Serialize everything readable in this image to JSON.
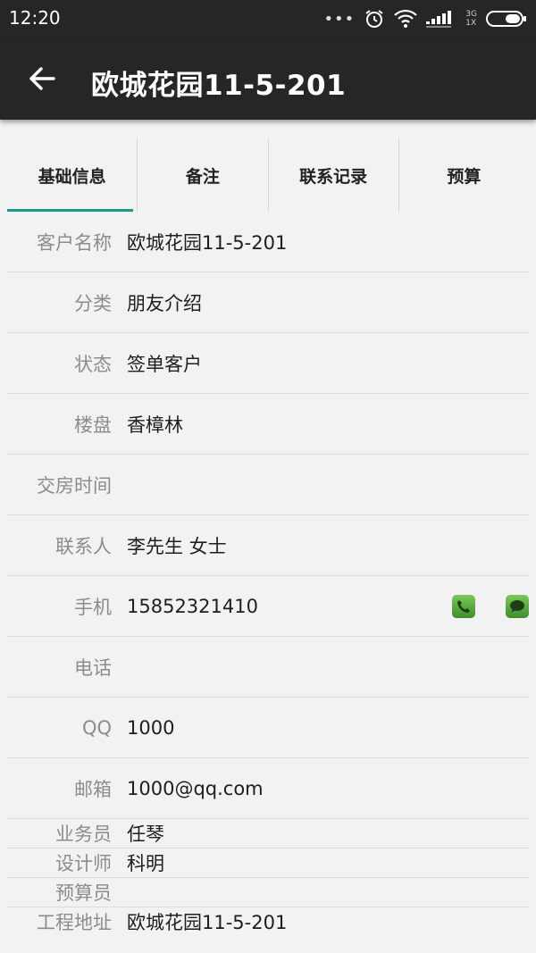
{
  "status": {
    "time": "12:20",
    "network_label_top": "3G",
    "network_label_bottom": "1X",
    "dots": "•••"
  },
  "app_bar": {
    "title": "欧城花园11-5-201"
  },
  "tabs": [
    {
      "label": "基础信息"
    },
    {
      "label": "备注"
    },
    {
      "label": "联系记录"
    },
    {
      "label": "预算"
    }
  ],
  "fields": [
    {
      "label": "客户名称",
      "value": "欧城花园11-5-201"
    },
    {
      "label": "分类",
      "value": "朋友介绍"
    },
    {
      "label": "状态",
      "value": "签单客户"
    },
    {
      "label": "楼盘",
      "value": "香樟林"
    },
    {
      "label": "交房时间",
      "value": ""
    },
    {
      "label": "联系人",
      "value": "李先生 女士"
    },
    {
      "label": "手机",
      "value": "15852321410"
    },
    {
      "label": "电话",
      "value": ""
    },
    {
      "label": "QQ",
      "value": "1000"
    },
    {
      "label": "邮箱",
      "value": "1000@qq.com"
    },
    {
      "label": "业务员",
      "value": "任琴"
    },
    {
      "label": "设计师",
      "value": "科明"
    },
    {
      "label": "预算员",
      "value": ""
    },
    {
      "label": "工程地址",
      "value": "欧城花园11-5-201"
    }
  ],
  "icons": {
    "call": "phone-icon",
    "sms": "message-icon"
  },
  "colors": {
    "accent": "#1a9a8a",
    "bar": "#262626",
    "action_green": "#4ea63a"
  }
}
